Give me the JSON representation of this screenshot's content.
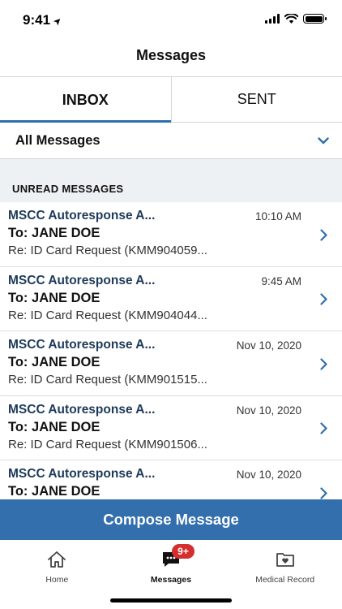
{
  "status_bar": {
    "time": "9:41",
    "location_arrow": "➤"
  },
  "header": {
    "title": "Messages"
  },
  "tabs": [
    {
      "label": "INBOX",
      "active": true
    },
    {
      "label": "SENT",
      "active": false
    }
  ],
  "filter": {
    "label": "All Messages"
  },
  "section": {
    "label": "UNREAD MESSAGES"
  },
  "messages": [
    {
      "sender": "MSCC Autoresponse A...",
      "date": "10:10 AM",
      "to": "To: JANE DOE",
      "subject": "Re: ID Card Request (KMM904059..."
    },
    {
      "sender": "MSCC Autoresponse A...",
      "date": "9:45 AM",
      "to": "To: JANE DOE",
      "subject": "Re: ID Card Request (KMM904044..."
    },
    {
      "sender": "MSCC Autoresponse A...",
      "date": "Nov 10, 2020",
      "to": "To: JANE DOE",
      "subject": "Re: ID Card Request (KMM901515..."
    },
    {
      "sender": "MSCC Autoresponse A...",
      "date": "Nov 10, 2020",
      "to": "To: JANE DOE",
      "subject": "Re: ID Card Request (KMM901506..."
    },
    {
      "sender": "MSCC Autoresponse A...",
      "date": "Nov 10, 2020",
      "to": "To: JANE DOE",
      "subject": ""
    }
  ],
  "compose": {
    "label": "Compose Message"
  },
  "tabbar": {
    "home": {
      "label": "Home",
      "icon": "home-icon"
    },
    "messages": {
      "label": "Messages",
      "icon": "chat-bubble-icon",
      "badge": "9+"
    },
    "medical_record": {
      "label": "Medical Record",
      "icon": "folder-heart-icon"
    }
  },
  "colors": {
    "accent": "#336fac",
    "tab_underline": "#2e6fae",
    "sender_text": "#1d3a5a",
    "badge": "#d32f2f",
    "section_bg": "#eef1f4"
  }
}
